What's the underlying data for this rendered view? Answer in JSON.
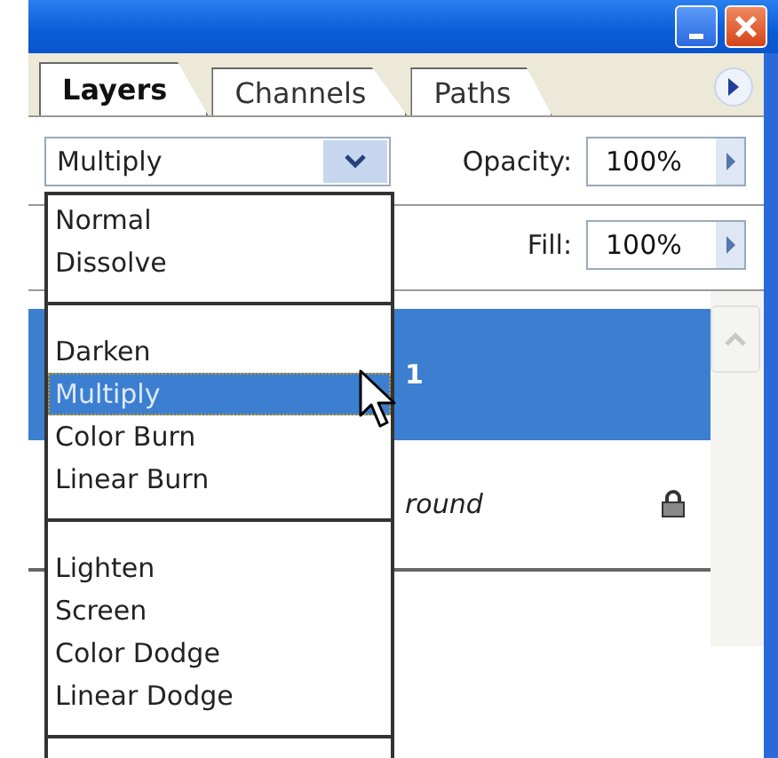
{
  "tabs": [
    {
      "label": "Layers",
      "selected": true
    },
    {
      "label": "Channels",
      "selected": false
    },
    {
      "label": "Paths",
      "selected": false
    }
  ],
  "blend_mode": {
    "value": "Multiply"
  },
  "opacity": {
    "label": "Opacity:",
    "value": "100%"
  },
  "fill": {
    "label": "Fill:",
    "value": "100%"
  },
  "layers": [
    {
      "name": "1",
      "selected": true,
      "italic": false,
      "locked": false
    },
    {
      "name": "round",
      "selected": false,
      "italic": true,
      "locked": true
    }
  ],
  "blend_menu": {
    "groups": [
      {
        "items": [
          {
            "label": "Normal",
            "selected": false
          },
          {
            "label": "Dissolve",
            "selected": false
          }
        ]
      },
      {
        "items": [
          {
            "label": "Darken",
            "selected": false
          },
          {
            "label": "Multiply",
            "selected": true
          },
          {
            "label": "Color Burn",
            "selected": false
          },
          {
            "label": "Linear Burn",
            "selected": false
          }
        ]
      },
      {
        "items": [
          {
            "label": "Lighten",
            "selected": false
          },
          {
            "label": "Screen",
            "selected": false
          },
          {
            "label": "Color Dodge",
            "selected": false
          },
          {
            "label": "Linear Dodge",
            "selected": false
          }
        ]
      }
    ]
  }
}
